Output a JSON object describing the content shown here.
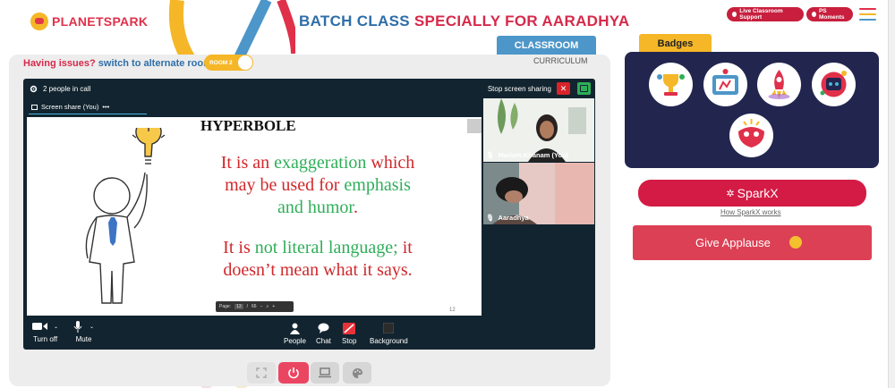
{
  "logo": {
    "text": "PLANETSPARK"
  },
  "header": {
    "title_part1": "BATCH CLASS",
    "title_part2": "SPECIALLY FOR AARADHYA"
  },
  "top_actions": {
    "live_support": "Live Classroom Support",
    "ps_moments": "PS Moments"
  },
  "tabs": {
    "classroom": "CLASSROOM",
    "curriculum": "CURRICULUM"
  },
  "issue_bar": {
    "question": "Having issues?",
    "link": "switch to alternate room",
    "toggle_label": "ROOM 2"
  },
  "call": {
    "people_count": "2 people in call",
    "stop_sharing": "Stop screen sharing",
    "screen_share_tab": "Screen share (You)",
    "more": "•••"
  },
  "slide": {
    "title": "HYPERBOLE",
    "line1_a": "It is an ",
    "line1_b": "exaggeration",
    "line1_c": " which",
    "line2_a": "may be used for ",
    "line2_b": "emphasis",
    "line3": "and humor",
    "line3_dot": ".",
    "line4_a": "It is ",
    "line4_b": "not literal language;",
    "line4_c": " it",
    "line5": "doesn’t mean what it says.",
    "pager_label": "Page:",
    "pager_current": "13",
    "pager_sep": "/",
    "pager_total": "66",
    "slide_number": "12"
  },
  "participants": [
    {
      "name": "Mariam Khanam (You)"
    },
    {
      "name": "Aaradhya"
    }
  ],
  "controls": {
    "turn_off": "Turn off",
    "mute": "Mute",
    "people": "People",
    "chat": "Chat",
    "stop": "Stop",
    "background": "Background"
  },
  "badges": {
    "title": "Badges",
    "items": [
      "trophy-badge",
      "hands-badge",
      "rocket-badge",
      "robot-badge",
      "mask-badge"
    ]
  },
  "sparkx": {
    "label": "SparkX",
    "link": "How SparkX works"
  },
  "applause": {
    "label": "Give Applause"
  },
  "colors": {
    "brand_red": "#d6294a",
    "brand_blue": "#2f6ea8",
    "brand_yellow": "#f5b727",
    "badges_bg": "#22264f",
    "call_bg": "#12242f"
  }
}
